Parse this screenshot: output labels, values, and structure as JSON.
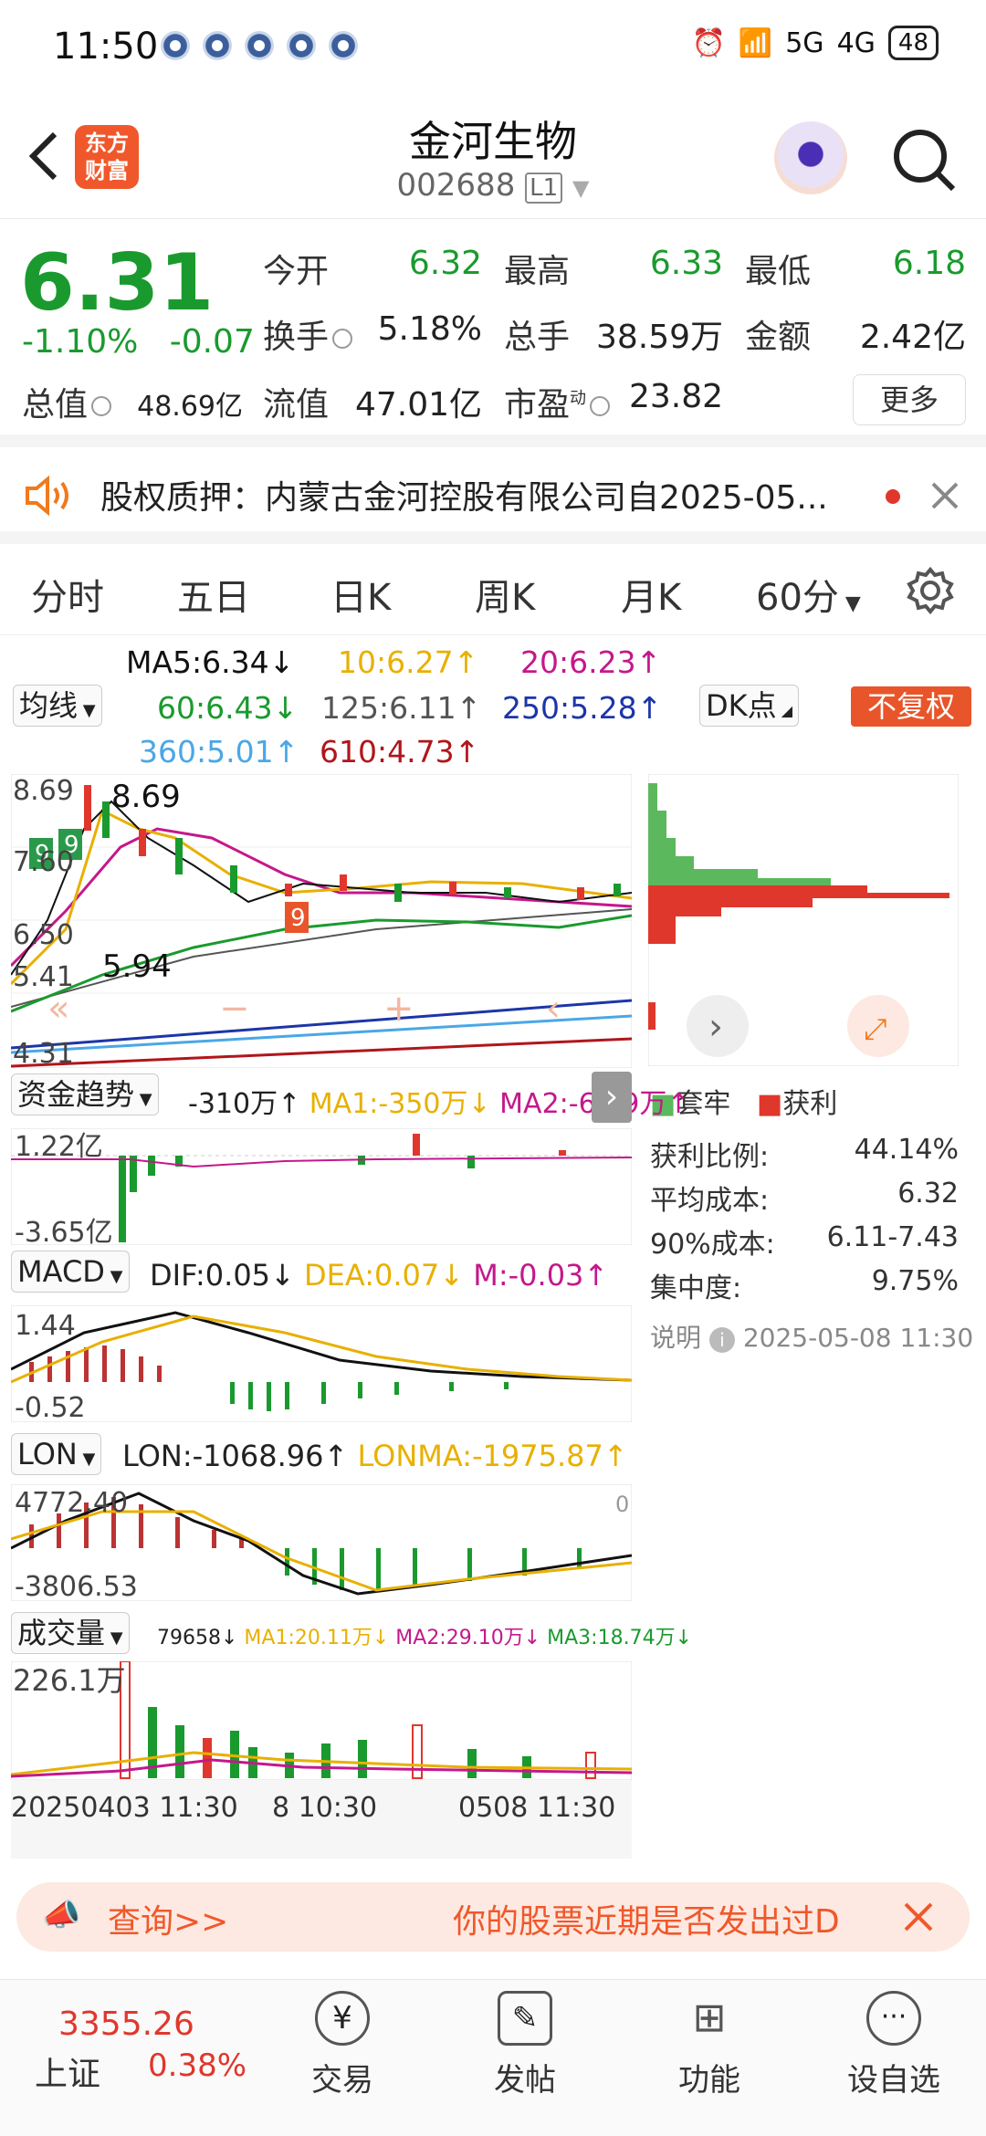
{
  "status_bar": {
    "time": "11:50",
    "network_5g": "5G",
    "network_4g": "4G",
    "battery": "48"
  },
  "header": {
    "brand_logo_text": "东方财富",
    "title": "金河生物",
    "code": "002688",
    "level": "L1"
  },
  "quote": {
    "price": "6.31",
    "change_pct": "-1.10%",
    "change_abs": "-0.07",
    "open_label": "今开",
    "open": "6.32",
    "high_label": "最高",
    "high": "6.33",
    "low_label": "最低",
    "low": "6.18",
    "turnover_label": "换手",
    "turnover": "5.18%",
    "volume_label": "总手",
    "volume": "38.59万",
    "amount_label": "金额",
    "amount": "2.42亿",
    "mcap_label": "总值",
    "mcap": "48.69亿",
    "float_label": "流值",
    "float": "47.01亿",
    "pe_label": "市盈",
    "pe_sup": "动",
    "pe": "23.82",
    "more_label": "更多"
  },
  "notice": {
    "text": "股权质押：内蒙古金河控股有限公司自2025-05..."
  },
  "tabs": {
    "items": [
      "分时",
      "五日",
      "日K",
      "周K",
      "月K",
      "60分"
    ],
    "active_index": 5
  },
  "indicators": {
    "ma_selector": "均线",
    "ma5": "MA5:6.34↓",
    "ma10": "10:6.27↑",
    "ma20": "20:6.23↑",
    "ma60": "60:6.43↓",
    "ma125": "125:6.11↑",
    "ma250": "250:5.28↑",
    "ma360": "360:5.01↑",
    "ma610": "610:4.73↑",
    "dk": "DK点",
    "fq": "不复权"
  },
  "kline": {
    "axis_high": "8.69",
    "axis_2": "7.60",
    "axis_3": "6.50",
    "axis_4": "5.41",
    "axis_low": "4.31",
    "max_mark": "8.69",
    "min_mark": "5.94"
  },
  "fund": {
    "selector": "资金趋势",
    "value": "-310万↑",
    "ma1": "MA1:-350万↓",
    "ma2": "MA2:-63.9万↑",
    "axis_top": "1.22亿",
    "axis_bottom": "-3.65亿"
  },
  "macd": {
    "selector": "MACD",
    "dif": "DIF:0.05↓",
    "dea": "DEA:0.07↓",
    "m": "M:-0.03↑",
    "axis_top": "1.44",
    "axis_bottom": "-0.52"
  },
  "lon": {
    "selector": "LON",
    "lon": "LON:-1068.96↑",
    "lonma": "LONMA:-1975.87↑",
    "axis_top": "4772.40",
    "axis_bottom": "-3806.53",
    "axis_right": "0"
  },
  "volume": {
    "selector": "成交量",
    "value": "79658↓",
    "ma1": "MA1:20.11万↓",
    "ma2": "MA2:29.10万↓",
    "ma3": "MA3:18.74万↓",
    "axis_top": "226.1万"
  },
  "time_axis": {
    "start": "20250403 11:30",
    "mid": "8 10:30",
    "end": "0508 11:30"
  },
  "chip": {
    "legend_trap": "套牢",
    "legend_profit": "获利",
    "profit_ratio_label": "获利比例:",
    "profit_ratio": "44.14%",
    "avg_cost_label": "平均成本:",
    "avg_cost": "6.32",
    "cost90_label": "90%成本:",
    "cost90": "6.11-7.43",
    "concentration_label": "集中度:",
    "concentration": "9.75%",
    "note_label": "说明",
    "note_time": "2025-05-08 11:30"
  },
  "ad": {
    "left": "查询>>",
    "right": "你的股票近期是否发出过D"
  },
  "nav": {
    "index_value": "3355.26",
    "index_name": "上证",
    "index_change": "0.38%",
    "trade": "交易",
    "post": "发帖",
    "func": "功能",
    "watch": "设自选"
  },
  "colors": {
    "up": "#e0372c",
    "down": "#1a9a2e",
    "accent": "#f07a1c"
  }
}
